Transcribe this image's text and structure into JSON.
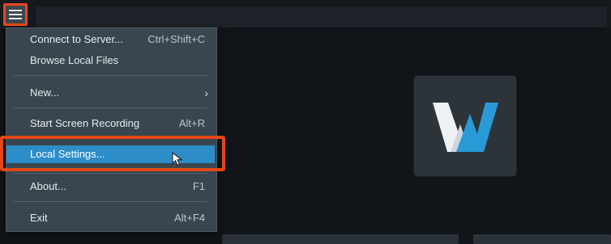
{
  "menu": {
    "items": [
      {
        "label": "Connect to Server...",
        "shortcut": "Ctrl+Shift+C"
      },
      {
        "label": "Browse Local Files",
        "shortcut": ""
      },
      {
        "label": "New...",
        "shortcut": ""
      },
      {
        "label": "Start Screen Recording",
        "shortcut": "Alt+R"
      },
      {
        "label": "Local Settings...",
        "shortcut": ""
      },
      {
        "label": "About...",
        "shortcut": "F1"
      },
      {
        "label": "Exit",
        "shortcut": "Alt+F4"
      }
    ],
    "submenu_arrow_item": "New...",
    "selected_item": "Local Settings..."
  },
  "icons": {
    "menu_button": "hamburger-icon",
    "logo": "app-logo-icon",
    "cursor": "mouse-pointer-icon",
    "submenu": "chevron-right-icon"
  },
  "colors": {
    "highlight": "#2d8dc8",
    "callout": "#e44716",
    "menu_background": "#3a464f",
    "logo_blue": "#2a9ad7"
  }
}
